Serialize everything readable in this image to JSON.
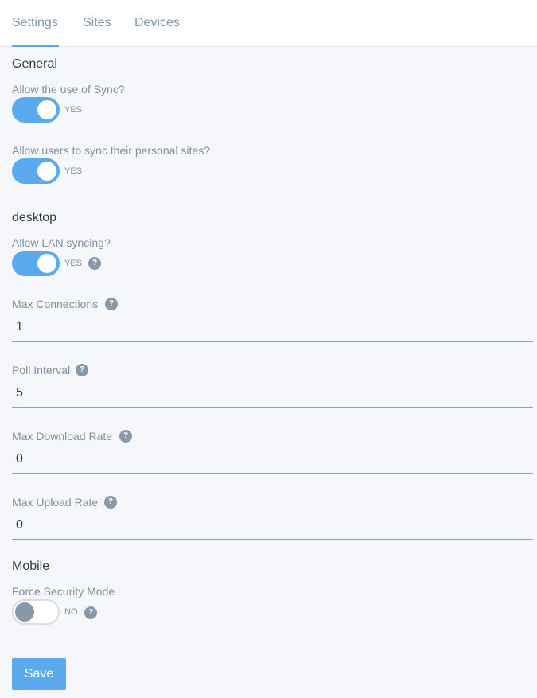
{
  "tabs": [
    {
      "label": "Settings",
      "active": true
    },
    {
      "label": "Sites",
      "active": false
    },
    {
      "label": "Devices",
      "active": false
    }
  ],
  "general": {
    "heading": "General",
    "allow_sync": {
      "label": "Allow the use of Sync?",
      "state": "YES",
      "on": true
    },
    "allow_personal": {
      "label": "Allow users to sync their personal sites?",
      "state": "YES",
      "on": true
    }
  },
  "desktop": {
    "heading": "desktop",
    "allow_lan": {
      "label": "Allow LAN syncing?",
      "state": "YES",
      "on": true
    },
    "max_connections": {
      "label": "Max Connections",
      "value": "1"
    },
    "poll_interval": {
      "label": "Poll Interval",
      "value": "5"
    },
    "max_download": {
      "label": "Max Download Rate",
      "value": "0"
    },
    "max_upload": {
      "label": "Max Upload Rate",
      "value": "0"
    }
  },
  "mobile": {
    "heading": "Mobile",
    "force_security": {
      "label": "Force Security Mode",
      "state": "NO",
      "on": false
    }
  },
  "help_glyph": "?",
  "save_label": "Save",
  "colors": {
    "accent": "#5baaf0",
    "muted": "#8798a9",
    "text": "#2c3e50"
  }
}
